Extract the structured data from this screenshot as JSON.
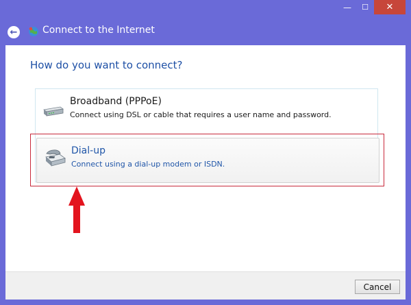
{
  "window": {
    "title": "Connect to the Internet",
    "controls": {
      "minimize": "—",
      "maximize": "☐",
      "close": "✕"
    },
    "accent_color": "#6a6ad8"
  },
  "content": {
    "heading": "How do you want to connect?",
    "options": [
      {
        "title": "Broadband (PPPoE)",
        "description": "Connect using DSL or cable that requires a user name and password.",
        "icon": "modem-icon"
      },
      {
        "title": "Dial-up",
        "description": "Connect using a dial-up modem or ISDN.",
        "icon": "telephone-icon",
        "highlighted": true
      }
    ]
  },
  "footer": {
    "cancel_label": "Cancel"
  },
  "annotation": {
    "color": "#e3141e"
  }
}
